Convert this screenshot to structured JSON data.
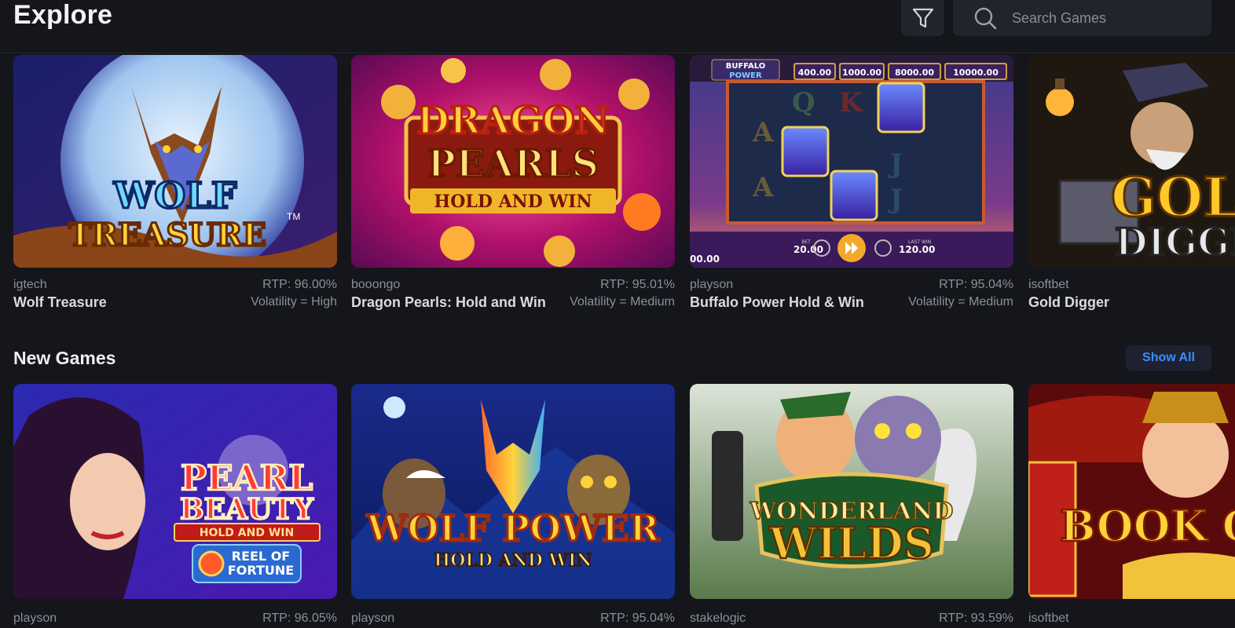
{
  "header": {
    "title": "Explore",
    "filter_icon": "filter-icon",
    "search_icon": "search-icon",
    "search_placeholder": "Search Games",
    "search_value": ""
  },
  "explore": {
    "cards": [
      {
        "provider": "igtech",
        "name": "Wolf Treasure",
        "rtp": "RTP: 96.00%",
        "volatility": "Volatility = High",
        "art": {
          "line1": "WOLF",
          "line2": "TREASURE",
          "tm": "TM"
        }
      },
      {
        "provider": "booongo",
        "name": "Dragon Pearls: Hold and Win",
        "rtp": "RTP: 95.01%",
        "volatility": "Volatility = Medium",
        "art": {
          "line1": "DRAGON",
          "line2": "PEARLS",
          "line3": "HOLD AND WIN"
        }
      },
      {
        "provider": "playson",
        "name": "Buffalo Power Hold & Win",
        "rtp": "RTP: 95.04%",
        "volatility": "Volatility = Medium",
        "art": {
          "logo1": "BUFFALO",
          "logo2": "POWER",
          "j1": "400.00",
          "j2": "1000.00",
          "j3": "8000.00",
          "j4": "10000.00",
          "left_value": "00.00",
          "bet": "20.00",
          "last_win": "120.00",
          "bet_label": "BET",
          "last_win_label": "LAST WIN",
          "sym_q": "Q",
          "sym_k": "K",
          "sym_a1": "A",
          "sym_a2": "A",
          "sym_j1": "J",
          "sym_j2": "J"
        }
      },
      {
        "provider": "isoftbet",
        "name": "Gold Digger",
        "rtp": "",
        "volatility": "",
        "art": {
          "line1": "GOL",
          "line2": "DIGGE"
        }
      }
    ]
  },
  "new_games": {
    "title": "New Games",
    "show_all_label": "Show All",
    "cards": [
      {
        "provider": "playson",
        "rtp": "RTP: 96.05%",
        "art": {
          "line1": "PEARL",
          "line2": "BEAUTY",
          "line3": "HOLD AND WIN",
          "line4": "REEL OF",
          "line5": "FORTUNE"
        }
      },
      {
        "provider": "playson",
        "rtp": "RTP: 95.04%",
        "art": {
          "line1": "WOLF POWER",
          "line2": "HOLD AND WIN"
        }
      },
      {
        "provider": "stakelogic",
        "rtp": "RTP: 93.59%",
        "art": {
          "line1": "WONDERLAND",
          "line2": "WILDS"
        }
      },
      {
        "provider": "isoftbet",
        "rtp": "",
        "art": {
          "line1": "BOOK OF TAI"
        }
      }
    ]
  }
}
